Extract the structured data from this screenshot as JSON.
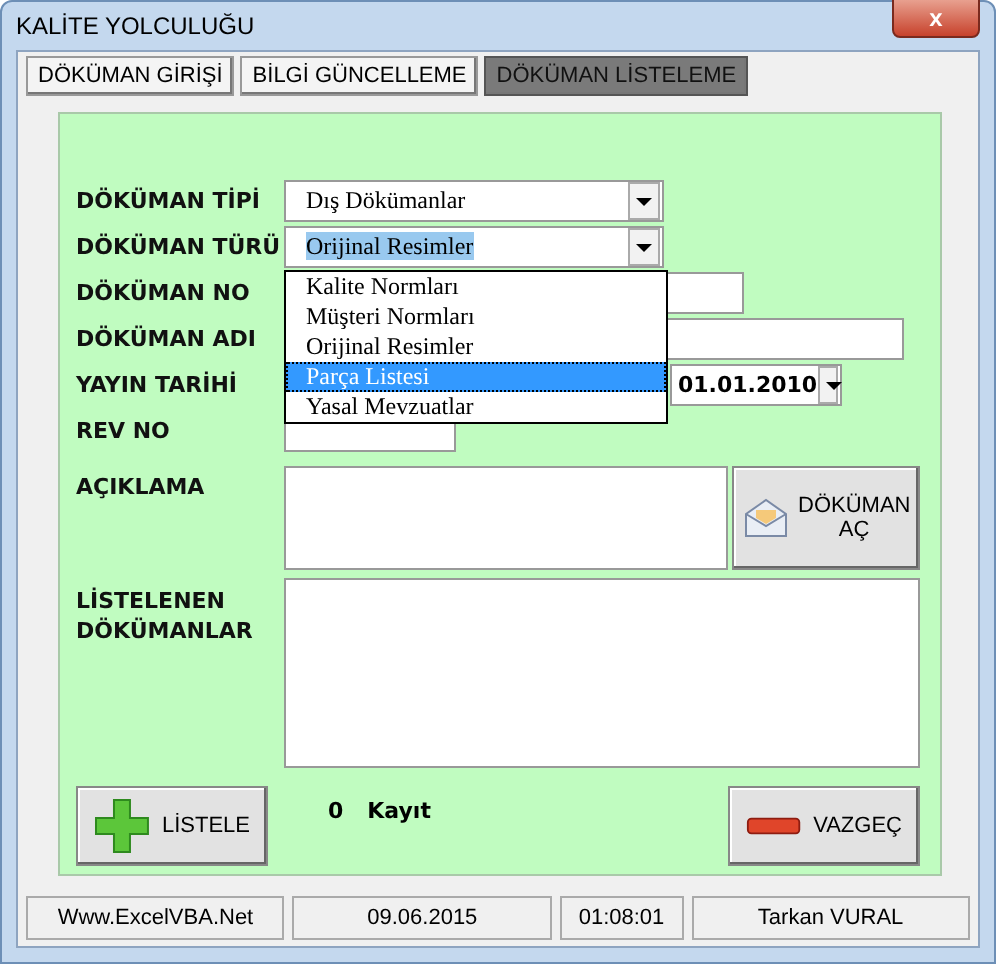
{
  "window": {
    "title": "KALİTE YOLCULUĞU",
    "close": "x"
  },
  "tabs": [
    {
      "label": "DÖKÜMAN GİRİŞİ",
      "selected": false
    },
    {
      "label": "BİLGİ GÜNCELLEME",
      "selected": false
    },
    {
      "label": "DÖKÜMAN LİSTELEME",
      "selected": true
    }
  ],
  "form": {
    "doc_type": {
      "label": "DÖKÜMAN TİPİ",
      "value": "Dış Dökümanlar"
    },
    "doc_kind": {
      "label": "DÖKÜMAN TÜRÜ",
      "value": "Orijinal Resimler",
      "expanded": true,
      "options": [
        {
          "label": "Kalite Normları",
          "highlighted": false
        },
        {
          "label": "Müşteri Normları",
          "highlighted": false
        },
        {
          "label": "Orijinal Resimler",
          "highlighted": false
        },
        {
          "label": "Parça Listesi",
          "highlighted": true
        },
        {
          "label": "Yasal Mevzuatlar",
          "highlighted": false
        }
      ]
    },
    "doc_no": {
      "label": "DÖKÜMAN NO"
    },
    "doc_name": {
      "label": "DÖKÜMAN ADI"
    },
    "publish_date": {
      "label": "YAYIN TARİHİ",
      "value": "01.01.2010"
    },
    "rev_no": {
      "label": "REV NO"
    },
    "description": {
      "label": "AÇIKLAMA"
    },
    "open_button": "DÖKÜMAN AÇ",
    "listed": {
      "label": "LİSTELENEN DÖKÜMANLAR"
    }
  },
  "list_button": "LİSTELE",
  "record_count": "0",
  "record_label": "Kayıt",
  "cancel_button": "VAZGEÇ",
  "status_bar": [
    "Www.ExcelVBA.Net",
    "09.06.2015",
    "01:08:01",
    "Tarkan VURAL"
  ]
}
